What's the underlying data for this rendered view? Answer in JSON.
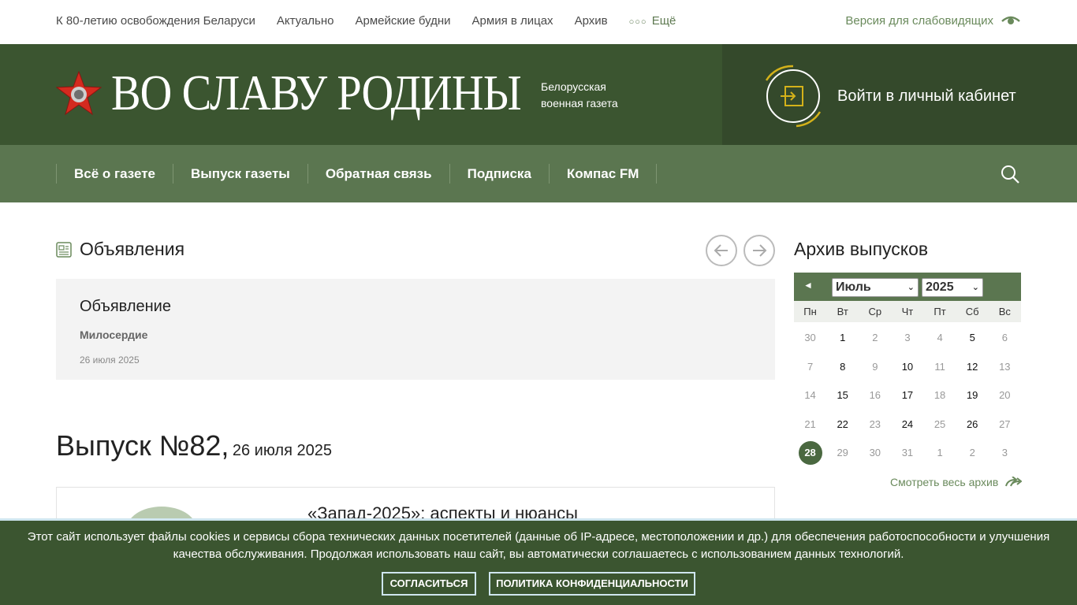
{
  "topnav": {
    "items": [
      "К 80-летию освобождения Беларуси",
      "Актуально",
      "Армейские будни",
      "Армия в лицах",
      "Архив"
    ],
    "more": "Ещё",
    "vision": "Версия для слабовидящих"
  },
  "header": {
    "title": "ВО СЛАВУ РОДИНЫ",
    "sub1": "Белорусская",
    "sub2": "военная газета",
    "login": "Войти в личный кабинет"
  },
  "mainnav": {
    "items": [
      "Всё о газете",
      "Выпуск газеты",
      "Обратная связь",
      "Подписка",
      "Компас FM"
    ]
  },
  "announcements": {
    "title": "Объявления",
    "item": {
      "title": "Объявление",
      "category": "Милосердие",
      "date": "26 июля 2025"
    }
  },
  "issue": {
    "number": "Выпуск №82,",
    "date": "26 июля 2025",
    "article_title": "«Запад-2025»: аспекты и нюансы"
  },
  "archive": {
    "title": "Архив выпусков",
    "prev": "◄",
    "month": "Июль",
    "year": "2025",
    "weekdays": [
      "Пн",
      "Вт",
      "Ср",
      "Чт",
      "Пт",
      "Сб",
      "Вс"
    ],
    "rows": [
      [
        {
          "d": "30",
          "h": false
        },
        {
          "d": "1",
          "h": true
        },
        {
          "d": "2",
          "h": false
        },
        {
          "d": "3",
          "h": false
        },
        {
          "d": "4",
          "h": false
        },
        {
          "d": "5",
          "h": true
        },
        {
          "d": "6",
          "h": false
        }
      ],
      [
        {
          "d": "7",
          "h": false
        },
        {
          "d": "8",
          "h": true
        },
        {
          "d": "9",
          "h": false
        },
        {
          "d": "10",
          "h": true
        },
        {
          "d": "11",
          "h": false
        },
        {
          "d": "12",
          "h": true
        },
        {
          "d": "13",
          "h": false
        }
      ],
      [
        {
          "d": "14",
          "h": false
        },
        {
          "d": "15",
          "h": true
        },
        {
          "d": "16",
          "h": false
        },
        {
          "d": "17",
          "h": true
        },
        {
          "d": "18",
          "h": false
        },
        {
          "d": "19",
          "h": true
        },
        {
          "d": "20",
          "h": false
        }
      ],
      [
        {
          "d": "21",
          "h": false
        },
        {
          "d": "22",
          "h": true
        },
        {
          "d": "23",
          "h": false
        },
        {
          "d": "24",
          "h": true
        },
        {
          "d": "25",
          "h": false
        },
        {
          "d": "26",
          "h": true
        },
        {
          "d": "27",
          "h": false
        }
      ],
      [
        {
          "d": "28",
          "h": true,
          "today": true
        },
        {
          "d": "29",
          "h": false
        },
        {
          "d": "30",
          "h": false
        },
        {
          "d": "31",
          "h": false
        },
        {
          "d": "1",
          "h": false
        },
        {
          "d": "2",
          "h": false
        },
        {
          "d": "3",
          "h": false
        }
      ]
    ],
    "view_all": "Смотреть весь архив"
  },
  "cookie": {
    "line1": "Этот сайт использует файлы cookies и сервисы сбора технических данных посетителей (данные об IP-адресе, местоположении и др.) для обеспечения работоспособности и улучшения",
    "line2": "качества обслуживания. Продолжая использовать наш сайт, вы автоматически соглашаетесь с использованием данных технологий.",
    "agree": "СОГЛАСИТЬСЯ",
    "policy": "ПОЛИТИКА КОНФИДЕНЦИАЛЬНОСТИ"
  },
  "colors": {
    "header": "#3b5530",
    "nav": "#5b7650",
    "accent": "#6a8a5c",
    "gold": "#d4b21a"
  }
}
